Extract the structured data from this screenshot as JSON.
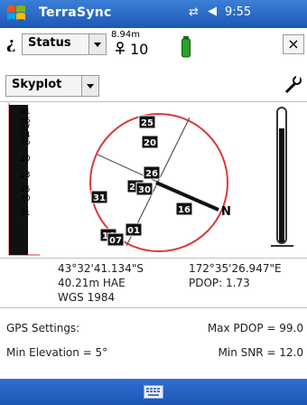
{
  "window": {
    "title": "TerraSync",
    "time": "9:55"
  },
  "toolbar": {
    "section_label": "Status",
    "accuracy_value": "8.94m",
    "satellite_count": "10",
    "view_label": "Skyplot",
    "close_glyph": "×"
  },
  "skyplot": {
    "north_label": "N",
    "satellites": [
      "25",
      "20",
      "26",
      "29",
      "30",
      "31",
      "16",
      "14",
      "07",
      "01"
    ]
  },
  "snr_bars": [
    {
      "id": "01",
      "level": 0.95
    },
    {
      "id": "06",
      "level": 0.1
    },
    {
      "id": "07",
      "level": 0.12
    },
    {
      "id": "14",
      "level": 0.14
    },
    {
      "id": "16",
      "level": 0.16
    },
    {
      "id": "20",
      "level": 0.3
    },
    {
      "id": "23",
      "level": 0.24
    },
    {
      "id": "25",
      "level": 0.32
    },
    {
      "id": "30",
      "level": 0.28
    },
    {
      "id": "31",
      "level": 0.36
    }
  ],
  "snr_labels": [
    "01",
    "06",
    "07",
    "14",
    "16",
    "20",
    "23",
    "25",
    "30",
    "31"
  ],
  "position": {
    "latitude": "43°32'41.134\"S",
    "longitude": "172°35'26.947\"E",
    "height": "40.21m HAE",
    "pdop": "PDOP: 1.73",
    "datum": "WGS 1984"
  },
  "gps_settings": {
    "heading": "GPS Settings:",
    "max_pdop": "Max PDOP = 99.0",
    "min_elevation": "Min Elevation = 5°",
    "min_snr": "Min SNR = 12.0"
  },
  "icons": {
    "start": "windows-flag-icon",
    "connectivity": "connectivity-icon",
    "volume": "speaker-icon",
    "satellite": "satellite-icon",
    "battery": "battery-icon",
    "settings": "wrench-icon",
    "keyboard": "keyboard-icon"
  },
  "colors": {
    "title_bar": "#1c58b7",
    "skyplot_circle": "#d83a3a",
    "bar_fill": "#111111",
    "battery": "#2aa12a"
  }
}
